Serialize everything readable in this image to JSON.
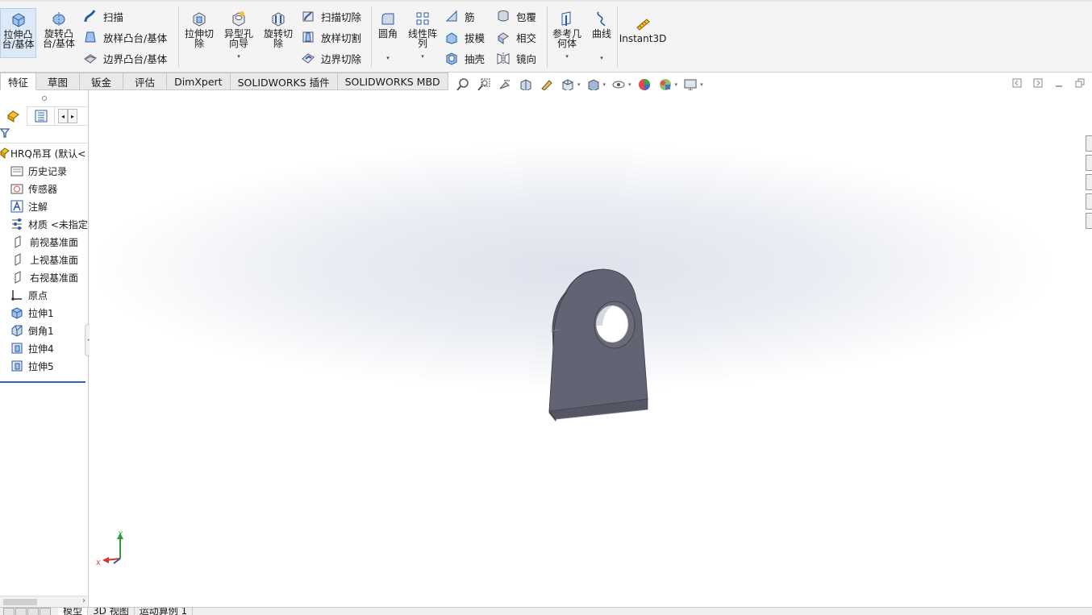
{
  "ribbon": {
    "extrude_boss": "拉伸凸\n台/基体",
    "revolve_boss": "旋转凸\n台/基体",
    "sweep": "扫描",
    "loft_boss": "放样凸台/基体",
    "boundary_boss": "边界凸台/基体",
    "extrude_cut": "拉伸切\n除",
    "hole_wizard": "异型孔\n向导",
    "revolve_cut": "旋转切\n除",
    "sweep_cut": "扫描切除",
    "loft_cut": "放样切割",
    "boundary_cut": "边界切除",
    "fillet": "圆角",
    "linear_pattern": "线性阵\n列",
    "rib": "筋",
    "draft": "拔模",
    "shell": "抽壳",
    "wrap": "包覆",
    "intersect": "相交",
    "mirror": "镜向",
    "ref_geometry": "参考几\n何体",
    "curves": "曲线",
    "instant3d": "Instant3D",
    "dropdown_glyph": "▾"
  },
  "tabs": [
    "特征",
    "草图",
    "钣金",
    "评估",
    "DimXpert",
    "SOLIDWORKS 插件",
    "SOLIDWORKS MBD"
  ],
  "feature_tree": {
    "part": "HRQ吊耳 (默认<",
    "items": [
      "历史记录",
      "传感器",
      "注解",
      "材质 <未指定",
      "前视基准面",
      "上视基准面",
      "右视基准面",
      "原点",
      "拉伸1",
      "倒角1",
      "拉伸4",
      "拉伸5"
    ]
  },
  "triad": {
    "x": "X",
    "y": "Y"
  },
  "bottom_tabs": [
    "模型",
    "3D 视图",
    "运动算例 1"
  ],
  "colors": {
    "part_face": "#636473",
    "part_edge": "#3a3b46",
    "selection_blue": "#2f62c9",
    "ribbon_bg": "#f4f4f4"
  }
}
